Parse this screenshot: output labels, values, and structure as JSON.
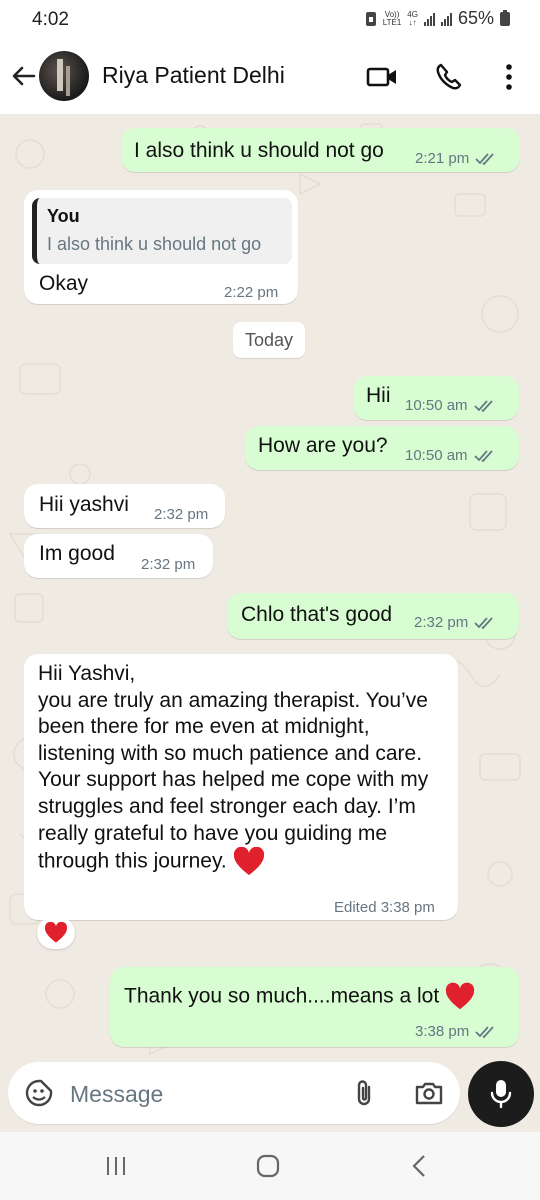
{
  "status": {
    "time": "4:02",
    "network_top": "Vo))",
    "network_bottom": "LTE1",
    "gen": "4G",
    "battery": "65%"
  },
  "header": {
    "contact_name": "Riya Patient Delhi"
  },
  "messages": [
    {
      "dir": "out",
      "text": "I also think u should not go",
      "time": "2:21 pm"
    },
    {
      "dir": "in",
      "quote_author": "You",
      "quote_text": "I also think u should not go",
      "text": "Okay",
      "time": "2:22 pm"
    },
    {
      "dir": "out",
      "text": "Hii",
      "time": "10:50 am"
    },
    {
      "dir": "out",
      "text": "How are you?",
      "time": "10:50 am"
    },
    {
      "dir": "in",
      "text": "Hii yashvi",
      "time": "2:32 pm"
    },
    {
      "dir": "in",
      "text": "Im good",
      "time": "2:32 pm"
    },
    {
      "dir": "out",
      "text": "Chlo that's good",
      "time": "2:32 pm"
    },
    {
      "dir": "in",
      "text": "Hii Yashvi,\nyou are truly an amazing therapist. You’ve been there for me even at midnight, listening with so much patience and care. Your support has helped me cope with my struggles and feel stronger each day. I’m really grateful to have you guiding me through this journey.",
      "time": "Edited 3:38 pm",
      "reaction": "heart"
    },
    {
      "dir": "out",
      "text": "Thank you so much....means a lot",
      "time": "3:38 pm"
    }
  ],
  "day_separator": "Today",
  "composer": {
    "placeholder": "Message"
  },
  "colors": {
    "outgoing": "#d9fdd3",
    "incoming": "#ffffff",
    "wallpaper": "#efeae2",
    "tick_read": "#667781",
    "heart": "#e0202c"
  },
  "icons": [
    "back-arrow-icon",
    "video-call-icon",
    "phone-icon",
    "more-options-icon",
    "sticker-icon",
    "attach-icon",
    "camera-icon",
    "mic-icon",
    "recents-icon",
    "home-icon",
    "nav-back-icon",
    "heart-emoji-icon",
    "double-tick-icon"
  ]
}
